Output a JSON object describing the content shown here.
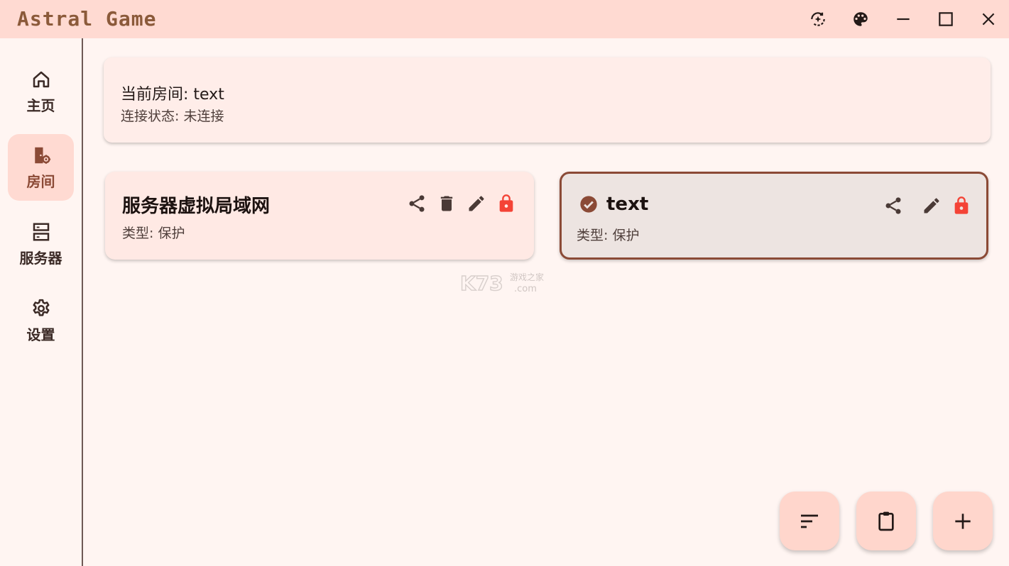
{
  "window": {
    "title": "Astral Game",
    "actions": [
      "mode-icon",
      "palette-icon",
      "minimize-icon",
      "maximize-icon",
      "close-icon"
    ]
  },
  "sidebar": {
    "items": [
      {
        "label": "主页",
        "icon": "home-icon",
        "active": false
      },
      {
        "label": "房间",
        "icon": "room-settings-icon",
        "active": true
      },
      {
        "label": "服务器",
        "icon": "server-icon",
        "active": false
      },
      {
        "label": "设置",
        "icon": "gear-icon",
        "active": false
      }
    ]
  },
  "status": {
    "room_line": "当前房间: text",
    "connection_line": "连接状态: 未连接"
  },
  "rooms": [
    {
      "name": "服务器虚拟局域网",
      "type_line": "类型: 保护",
      "selected": false,
      "actions": [
        "share-icon",
        "delete-icon",
        "edit-icon",
        "lock-icon"
      ]
    },
    {
      "name": "text",
      "type_line": "类型: 保护",
      "selected": true,
      "actions": [
        "share-icon",
        "edit-icon",
        "lock-icon"
      ]
    }
  ],
  "watermark": {
    "brand": "K73",
    "tagline": "游戏之家",
    "domain": ".com"
  },
  "fabs": [
    "sort-icon",
    "clipboard-icon",
    "add-icon"
  ],
  "colors": {
    "titlebar_bg": "#ffdad2",
    "page_bg": "#fff5f2",
    "accent": "#8b4a36",
    "lock": "#f44336",
    "fab_bg": "#ffd6cc"
  }
}
